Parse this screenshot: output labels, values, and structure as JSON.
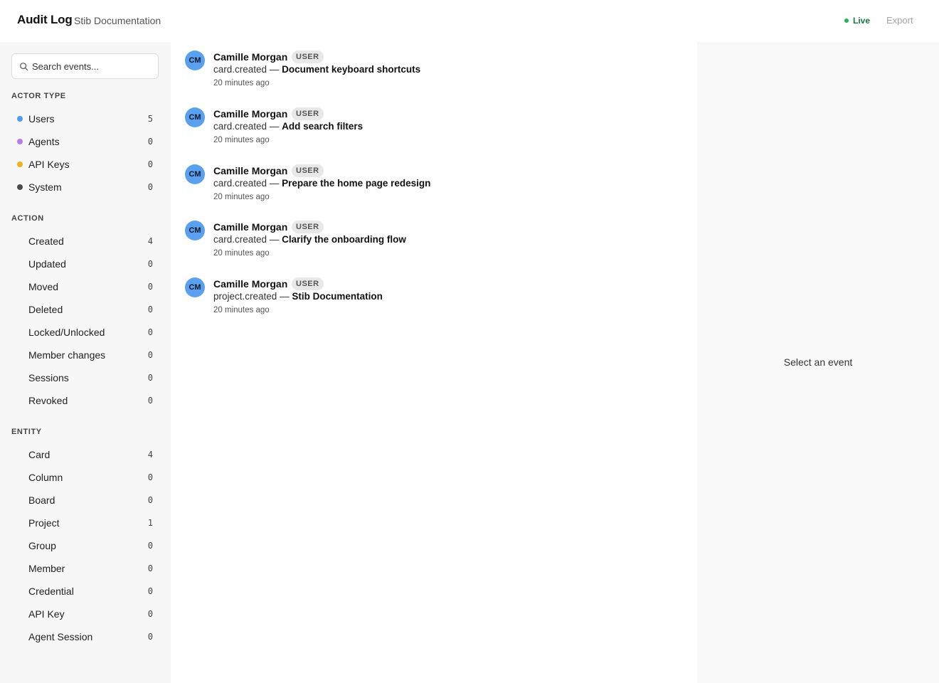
{
  "header": {
    "title": "Audit Log",
    "subtitle": "Stib Documentation",
    "live_label": "Live",
    "export_label": "Export"
  },
  "sidebar": {
    "search_placeholder": "Search events...",
    "actor_type": {
      "title": "ACTOR TYPE",
      "items": [
        {
          "label": "Users",
          "count": "5",
          "color": "#4c9cf0"
        },
        {
          "label": "Agents",
          "count": "0",
          "color": "#b57be8"
        },
        {
          "label": "API Keys",
          "count": "0",
          "color": "#f0b21c"
        },
        {
          "label": "System",
          "count": "0",
          "color": "#4a4a4a"
        }
      ]
    },
    "action": {
      "title": "ACTION",
      "items": [
        {
          "label": "Created",
          "count": "4"
        },
        {
          "label": "Updated",
          "count": "0"
        },
        {
          "label": "Moved",
          "count": "0"
        },
        {
          "label": "Deleted",
          "count": "0"
        },
        {
          "label": "Locked/Unlocked",
          "count": "0"
        },
        {
          "label": "Member changes",
          "count": "0"
        },
        {
          "label": "Sessions",
          "count": "0"
        },
        {
          "label": "Revoked",
          "count": "0"
        }
      ]
    },
    "entity": {
      "title": "ENTITY",
      "items": [
        {
          "label": "Card",
          "count": "4"
        },
        {
          "label": "Column",
          "count": "0"
        },
        {
          "label": "Board",
          "count": "0"
        },
        {
          "label": "Project",
          "count": "1"
        },
        {
          "label": "Group",
          "count": "0"
        },
        {
          "label": "Member",
          "count": "0"
        },
        {
          "label": "Credential",
          "count": "0"
        },
        {
          "label": "API Key",
          "count": "0"
        },
        {
          "label": "Agent Session",
          "count": "0"
        }
      ]
    }
  },
  "events": [
    {
      "initials": "CM",
      "actor": "Camille Morgan",
      "badge": "USER",
      "action": "card.created",
      "separator": "—",
      "target": "Document keyboard shortcuts",
      "time": "20 minutes ago"
    },
    {
      "initials": "CM",
      "actor": "Camille Morgan",
      "badge": "USER",
      "action": "card.created",
      "separator": "—",
      "target": "Add search filters",
      "time": "20 minutes ago"
    },
    {
      "initials": "CM",
      "actor": "Camille Morgan",
      "badge": "USER",
      "action": "card.created",
      "separator": "—",
      "target": "Prepare the home page redesign",
      "time": "20 minutes ago"
    },
    {
      "initials": "CM",
      "actor": "Camille Morgan",
      "badge": "USER",
      "action": "card.created",
      "separator": "—",
      "target": "Clarify the onboarding flow",
      "time": "20 minutes ago"
    },
    {
      "initials": "CM",
      "actor": "Camille Morgan",
      "badge": "USER",
      "action": "project.created",
      "separator": "—",
      "target": "Stib Documentation",
      "time": "20 minutes ago"
    }
  ],
  "detail": {
    "empty_text": "Select an event"
  }
}
